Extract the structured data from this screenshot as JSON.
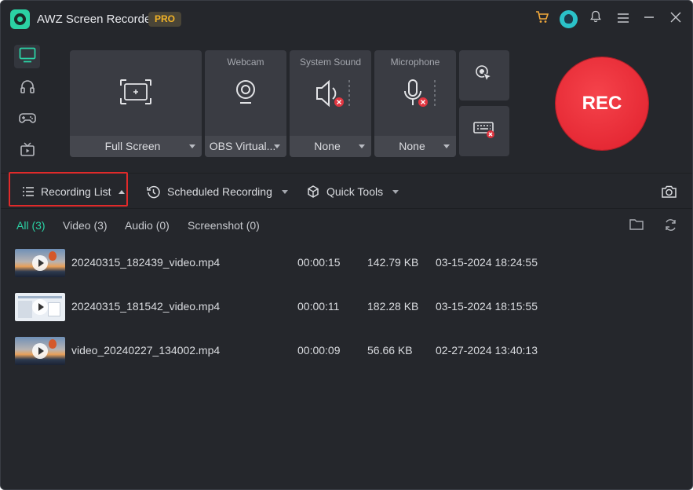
{
  "app": {
    "title": "AWZ Screen Recorder",
    "badge": "PRO"
  },
  "sidebar": {
    "items": [
      {
        "name": "screen",
        "icon": "monitor-icon",
        "active": true
      },
      {
        "name": "audio",
        "icon": "headphones-icon",
        "active": false
      },
      {
        "name": "game",
        "icon": "gamepad-icon",
        "active": false
      },
      {
        "name": "tv",
        "icon": "tv-icon",
        "active": false
      }
    ]
  },
  "controls": {
    "area": {
      "label": "Full Screen"
    },
    "webcam": {
      "title": "Webcam",
      "value": "OBS Virtual..."
    },
    "system_sound": {
      "title": "System Sound",
      "value": "None"
    },
    "microphone": {
      "title": "Microphone",
      "value": "None"
    },
    "rec_label": "REC"
  },
  "toolbar": {
    "recording_list": "Recording List",
    "scheduled_recording": "Scheduled Recording",
    "quick_tools": "Quick Tools"
  },
  "filters": [
    {
      "label": "All (3)",
      "active": true
    },
    {
      "label": "Video (3)",
      "active": false
    },
    {
      "label": "Audio (0)",
      "active": false
    },
    {
      "label": "Screenshot (0)",
      "active": false
    }
  ],
  "files": [
    {
      "name": "20240315_182439_video.mp4",
      "duration": "00:00:15",
      "size": "142.79 KB",
      "date": "03-15-2024 18:24:55",
      "thumb": "sunset"
    },
    {
      "name": "20240315_181542_video.mp4",
      "duration": "00:00:11",
      "size": "182.28 KB",
      "date": "03-15-2024 18:15:55",
      "thumb": "doc"
    },
    {
      "name": "video_20240227_134002.mp4",
      "duration": "00:00:09",
      "size": "56.66 KB",
      "date": "02-27-2024 13:40:13",
      "thumb": "sunset"
    }
  ],
  "colors": {
    "accent": "#2bd1a4",
    "rec": "#e5252f",
    "highlight": "#e02a2a",
    "pro": "#f2b327",
    "background": "#25272c"
  }
}
